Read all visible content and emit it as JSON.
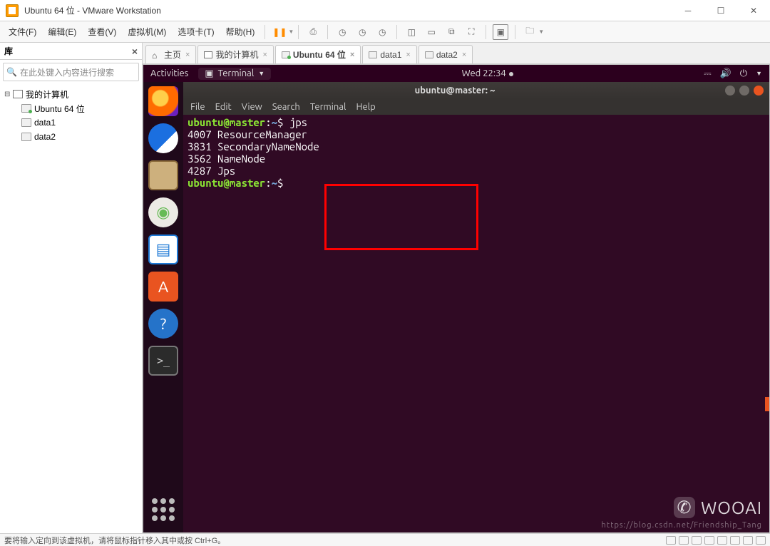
{
  "window": {
    "title": "Ubuntu 64 位 - VMware Workstation"
  },
  "menubar": {
    "items": [
      "文件(F)",
      "编辑(E)",
      "查看(V)",
      "虚拟机(M)",
      "选项卡(T)",
      "帮助(H)"
    ]
  },
  "sidebar": {
    "title": "库",
    "search_placeholder": "在此处键入内容进行搜索",
    "root": "我的计算机",
    "items": [
      "Ubuntu 64 位",
      "data1",
      "data2"
    ]
  },
  "tabs": [
    {
      "label": "主页",
      "type": "home",
      "active": false
    },
    {
      "label": "我的计算机",
      "type": "monitor",
      "active": false
    },
    {
      "label": "Ubuntu 64 位",
      "type": "vm-on",
      "active": true
    },
    {
      "label": "data1",
      "type": "vm",
      "active": false
    },
    {
      "label": "data2",
      "type": "vm",
      "active": false
    }
  ],
  "gnome": {
    "activities": "Activities",
    "app_label": "Terminal",
    "clock": "Wed 22:34"
  },
  "terminal": {
    "title": "ubuntu@master: ~",
    "menus": [
      "File",
      "Edit",
      "View",
      "Search",
      "Terminal",
      "Help"
    ],
    "prompt_user": "ubuntu@master",
    "prompt_sep": ":",
    "prompt_path": "~",
    "prompt_char": "$",
    "cmd1": "jps",
    "out1": "4007 ResourceManager",
    "out2": "3831 SecondaryNameNode",
    "out3": "3562 NameNode",
    "out4": "4287 Jps"
  },
  "statusbar": {
    "hint": "要将输入定向到该虚拟机，请将鼠标指针移入其中或按 Ctrl+G。"
  },
  "watermark": {
    "text": "WOOAI",
    "sub": "https://blog.csdn.net/Friendship_Tang"
  }
}
